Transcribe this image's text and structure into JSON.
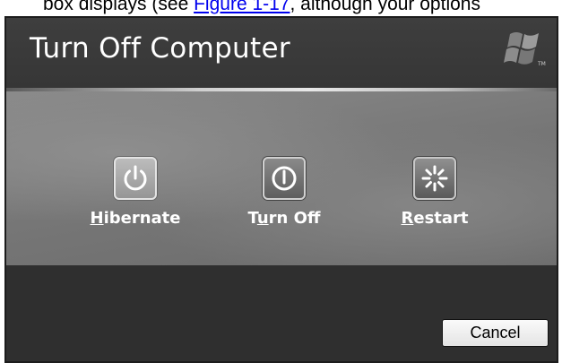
{
  "document": {
    "text_before_link": "box displays (see ",
    "link_text": "Figure 1-17",
    "text_after_link": ", although your options"
  },
  "dialog": {
    "title": "Turn Off Computer",
    "logo_icon": "windows-flag-logo",
    "options": [
      {
        "access_key": "H",
        "rest": "ibernate",
        "label": "Hibernate",
        "icon": "power-icon"
      },
      {
        "pre": "T",
        "access_key": "u",
        "rest": "rn Off",
        "label": "Turn Off",
        "icon": "power-off-icon"
      },
      {
        "access_key": "R",
        "rest": "estart",
        "label": "Restart",
        "icon": "restart-icon"
      }
    ],
    "cancel_label": "Cancel"
  },
  "colors": {
    "header_bg": "#3a3a3a",
    "panel_bg": "#7a7a7a",
    "title_text": "#ffffff"
  }
}
